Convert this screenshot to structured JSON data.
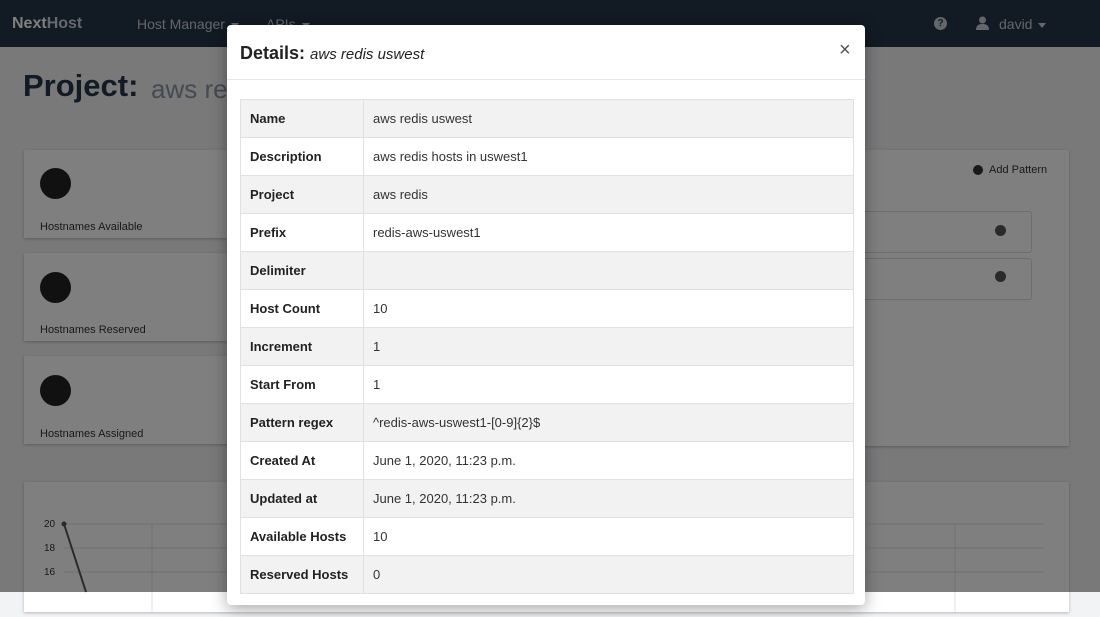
{
  "navbar": {
    "brand_next": "Next",
    "brand_host": "Host",
    "host_manager": "Host Manager",
    "apis": "APIs",
    "username": "david"
  },
  "page": {
    "title": "Project:",
    "subtitle": "aws redis uswest"
  },
  "stats": [
    {
      "label": "Hostnames Available",
      "icon": "check-icon"
    },
    {
      "label": "Hostnames Reserved",
      "icon": "pause-icon"
    },
    {
      "label": "Hostnames Assigned",
      "icon": "stop-icon"
    }
  ],
  "patterns": {
    "add_label": "Add Pattern"
  },
  "chart": {
    "y_ticks": [
      "20",
      "18",
      "16"
    ]
  },
  "modal": {
    "title_prefix": "Details:",
    "title_name": "aws redis uswest",
    "close": "×",
    "rows": [
      {
        "key": "Name",
        "value": "aws redis uswest"
      },
      {
        "key": "Description",
        "value": "aws redis hosts in uswest1"
      },
      {
        "key": "Project",
        "value": "aws redis"
      },
      {
        "key": "Prefix",
        "value": "redis-aws-uswest1"
      },
      {
        "key": "Delimiter",
        "value": ""
      },
      {
        "key": "Host Count",
        "value": "10"
      },
      {
        "key": "Increment",
        "value": "1"
      },
      {
        "key": "Start From",
        "value": "1"
      },
      {
        "key": "Pattern regex",
        "value": "^redis-aws-uswest1-[0-9]{2}$"
      },
      {
        "key": "Created At",
        "value": "June 1, 2020, 11:23 p.m."
      },
      {
        "key": "Updated at",
        "value": "June 1, 2020, 11:23 p.m."
      },
      {
        "key": "Available Hosts",
        "value": "10"
      },
      {
        "key": "Reserved Hosts",
        "value": "0"
      }
    ]
  }
}
